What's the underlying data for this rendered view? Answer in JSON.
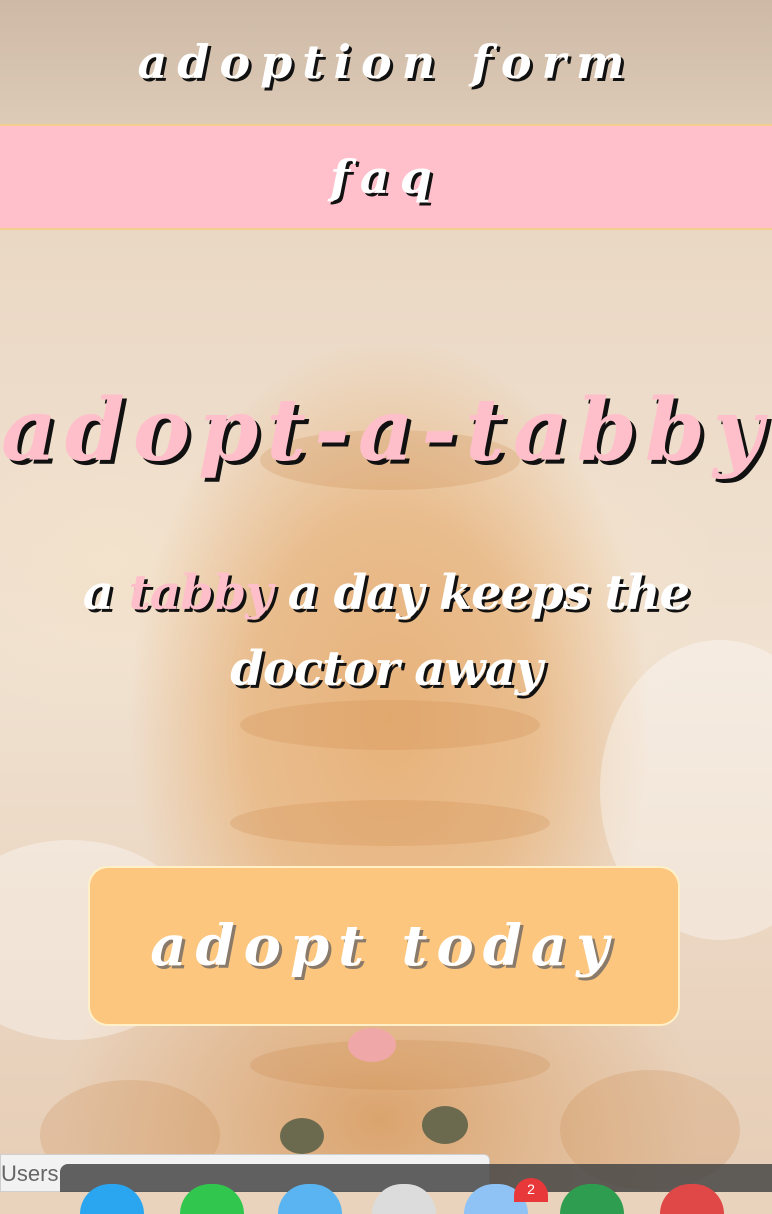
{
  "nav": {
    "adoption_form": "adoption form",
    "faq": "faq"
  },
  "hero": {
    "title": "adopt-a-tabby",
    "tagline_prefix": "a",
    "tagline_highlight": "tabby",
    "tagline_suffix": "a day keeps the doctor away"
  },
  "cta": {
    "label": "adopt today"
  },
  "browser_status": {
    "text": "Users"
  },
  "dock": {
    "badge_count": "2"
  },
  "colors": {
    "pink_accent": "#ffc0cb",
    "button_orange": "#fcc67e",
    "divider_gold": "#f5cd8c"
  }
}
